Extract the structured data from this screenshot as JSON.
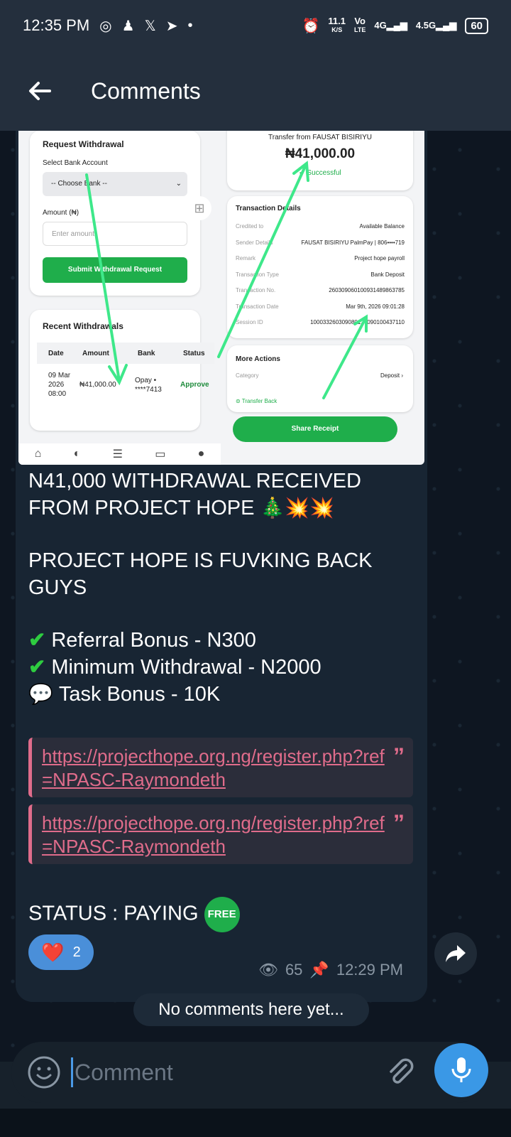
{
  "status_bar": {
    "time": "12:35 PM",
    "net_speed_top": "11.1",
    "net_speed_bottom": "K/S",
    "volte_top": "Vo",
    "volte_bottom": "LTE",
    "network_1": "4G",
    "network_2": "4.5G",
    "battery": "60"
  },
  "header": {
    "title": "Comments"
  },
  "media": {
    "withdraw_title": "Request Withdrawal",
    "select_bank_label": "Select Bank Account",
    "bank_select_value": "-- Choose Bank --",
    "amount_label": "Amount (₦)",
    "amount_placeholder": "Enter amount",
    "submit_button": "Submit Withdrawal Request",
    "recent_title": "Recent Withdrawals",
    "table_headers": [
      "Date",
      "Amount",
      "Bank",
      "Status"
    ],
    "row": {
      "date": "09 Mar 2026 08:00",
      "amount": "₦41,000.00",
      "bank": "Opay • ****7413",
      "status": "Approve"
    },
    "transfer_from": "Transfer from FAUSAT BISIRIYU",
    "transfer_amount": "₦41,000.00",
    "transfer_status": "Successful",
    "details_title": "Transaction Details",
    "details": [
      {
        "label": "Credited to",
        "value": "Available Balance"
      },
      {
        "label": "Sender Details",
        "value": "FAUSAT BISIRIYU PalmPay | 806••••719"
      },
      {
        "label": "Remark",
        "value": "Project hope payroll"
      },
      {
        "label": "Transaction Type",
        "value": "Bank Deposit"
      },
      {
        "label": "Transaction No.",
        "value": "260309060100931489863785"
      },
      {
        "label": "Transaction Date",
        "value": "Mar 9th, 2026 09:01:28"
      },
      {
        "label": "Session ID",
        "value": "100033260309080127090100437110"
      }
    ],
    "more_actions_title": "More Actions",
    "category_label": "Category",
    "category_value": "Deposit",
    "transfer_back": "Transfer Back",
    "share_receipt": "Share Receipt"
  },
  "message": {
    "line1": "N41,000 WITHDRAWAL RECEIVED",
    "line2": "FROM PROJECT HOPE",
    "line2_emoji": "🎄💥💥",
    "line3": "PROJECT HOPE IS FUVKING BACK",
    "line4": "GUYS",
    "bullet1": "Referral Bonus - N300",
    "bullet2": "Minimum Withdrawal - N2000",
    "bullet3": "Task Bonus - 10K",
    "bullet3_emoji": "💬",
    "link1": "https://projecthope.org.ng/register.php?ref=NPASC-Raymondeth",
    "link2": "https://projecthope.org.ng/register.php?ref=NPASC-Raymondeth",
    "status_line": "STATUS : PAYING",
    "status_badge": "FREE"
  },
  "reaction": {
    "emoji": "❤️",
    "count": "2"
  },
  "meta": {
    "views": "65",
    "time": "12:29 PM"
  },
  "no_comments": "No comments here yet...",
  "input": {
    "placeholder": "Comment"
  }
}
